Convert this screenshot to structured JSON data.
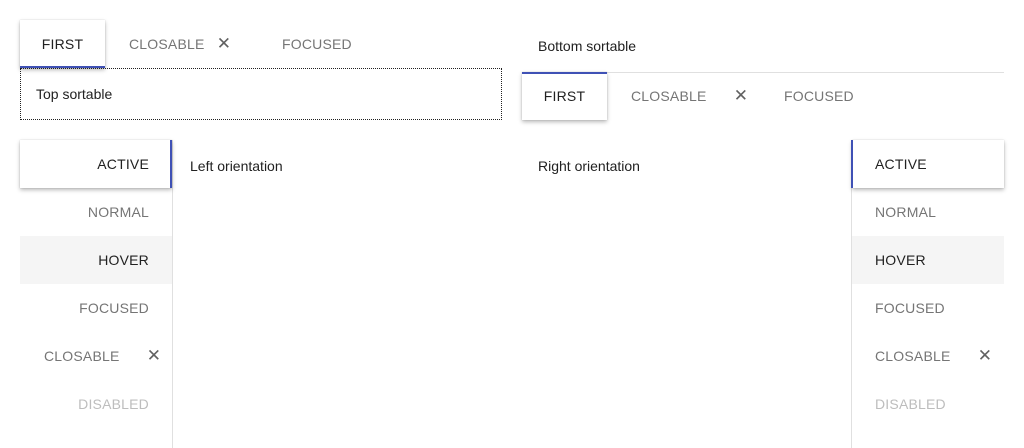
{
  "top_sortable": {
    "tabs": [
      {
        "label": "FIRST"
      },
      {
        "label": "CLOSABLE"
      },
      {
        "label": "FOCUSED"
      }
    ],
    "content": "Top sortable"
  },
  "bottom_sortable": {
    "tabs": [
      {
        "label": "FIRST"
      },
      {
        "label": "CLOSABLE"
      },
      {
        "label": "FOCUSED"
      }
    ],
    "content": "Bottom sortable"
  },
  "left_orientation": {
    "tabs": [
      {
        "label": "ACTIVE"
      },
      {
        "label": "NORMAL"
      },
      {
        "label": "HOVER"
      },
      {
        "label": "FOCUSED"
      },
      {
        "label": "CLOSABLE"
      },
      {
        "label": "DISABLED"
      }
    ],
    "content": "Left orientation"
  },
  "right_orientation": {
    "tabs": [
      {
        "label": "ACTIVE"
      },
      {
        "label": "NORMAL"
      },
      {
        "label": "HOVER"
      },
      {
        "label": "FOCUSED"
      },
      {
        "label": "CLOSABLE"
      },
      {
        "label": "DISABLED"
      }
    ],
    "content": "Right orientation"
  },
  "icons": {
    "close": "close-icon"
  },
  "colors": {
    "indicator": "#3f51b5",
    "hover_bg": "#f5f5f5",
    "disabled_text": "#bdbdbd"
  }
}
